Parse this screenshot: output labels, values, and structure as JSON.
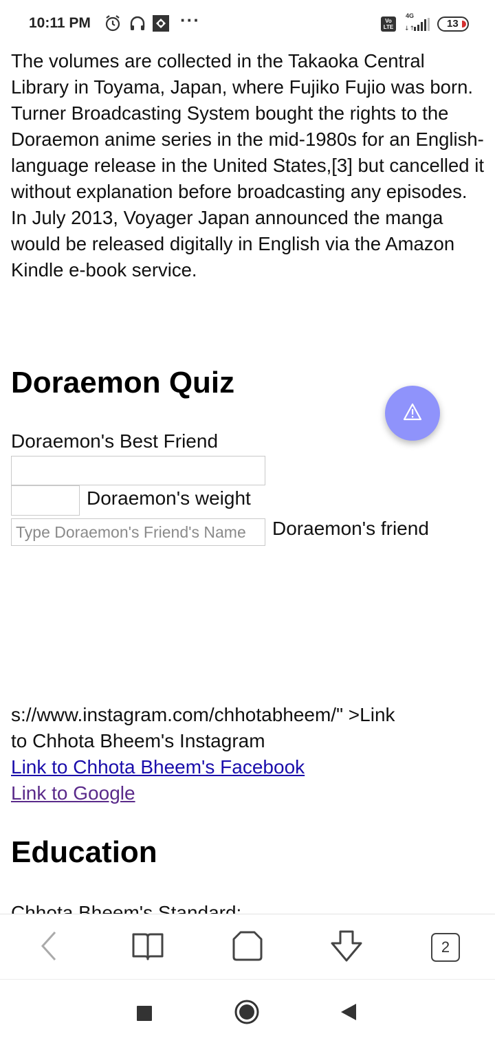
{
  "status_bar": {
    "time": "10:11 PM",
    "icons": [
      "alarm-icon",
      "headphones-icon",
      "screen-cast-icon",
      "more-dots-icon"
    ],
    "more": "···",
    "volte": "Vo LTE",
    "network": "4G",
    "battery": "13"
  },
  "article": {
    "paragraph": "The volumes are collected in the Takaoka Central Library in Toyama, Japan, where Fujiko Fujio was born. Turner Broadcasting System bought the rights to the Doraemon anime series in the mid-1980s for an English-language release in the United States,[3] but cancelled it without explanation before broadcasting any episodes. In July 2013, Voyager Japan announced the manga would be released digitally in English via the Amazon Kindle e-book service."
  },
  "quiz": {
    "heading": "Doraemon Quiz",
    "best_friend_label": "Doraemon's Best Friend",
    "best_friend_value": "",
    "weight_value": "",
    "weight_label": "Doraemon's weight",
    "friend_placeholder": "Type Doraemon's Friend's Name",
    "friend_label": "Doraemon's friend"
  },
  "links": {
    "raw_text_line1": "s://www.instagram.com/chhotabheem/\" >Link",
    "raw_text_line2": "to Chhota Bheem's Instagram",
    "facebook": "Link to Chhota Bheem's Facebook",
    "google": "Link to Google"
  },
  "education": {
    "heading": "Education",
    "partial_text": "Chhota Bheem's Standard:"
  },
  "fab": {
    "icon": "warning-icon",
    "color": "#8f93fb"
  },
  "browser_toolbar": {
    "buttons": [
      "back-icon",
      "bookmarks-icon",
      "home-icon",
      "download-icon"
    ],
    "tab_count": "2"
  },
  "nav_bar": {
    "buttons": [
      "recents-icon",
      "home-icon",
      "back-icon"
    ]
  },
  "colors": {
    "link": "#1a0dab",
    "link_visited": "#5a2a8a",
    "battery_low": "#d32f2f"
  }
}
